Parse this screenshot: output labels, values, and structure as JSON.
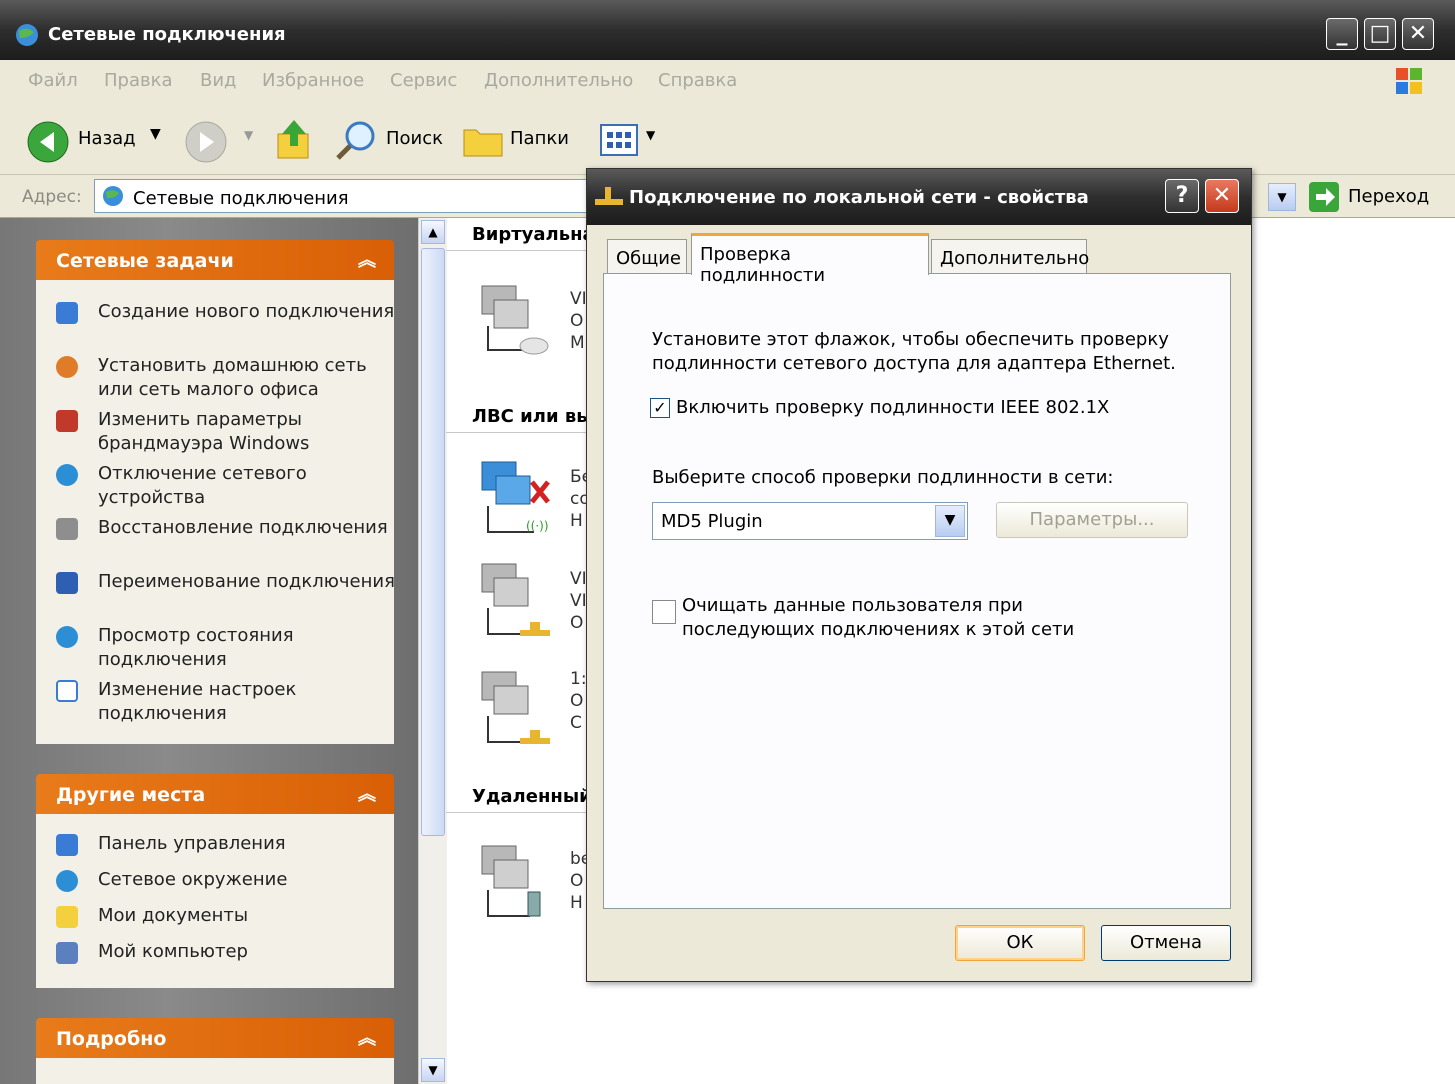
{
  "window": {
    "title": "Сетевые подключения"
  },
  "menu": [
    "Файл",
    "Правка",
    "Вид",
    "Избранное",
    "Сервис",
    "Дополнительно",
    "Справка"
  ],
  "toolbar": {
    "back": "Назад",
    "search": "Поиск",
    "folders": "Папки"
  },
  "address": {
    "label": "Адрес:",
    "value": "Сетевые подключения",
    "go": "Переход"
  },
  "left": {
    "tasks": {
      "title": "Сетевые задачи",
      "items": [
        "Создание нового подключения",
        "Установить домашнюю сеть или сеть малого офиса",
        "Изменить параметры брандмауэра Windows",
        "Отключение сетевого устройства",
        "Восстановление подключения",
        "Переименование подключения",
        "Просмотр состояния подключения",
        "Изменение настроек подключения"
      ]
    },
    "places": {
      "title": "Другие места",
      "items": [
        "Панель управления",
        "Сетевое окружение",
        "Мои документы",
        "Мой компьютер"
      ]
    },
    "details": {
      "title": "Подробно"
    }
  },
  "content": {
    "sections": [
      "Виртуальна",
      "ЛВС или вы",
      "Удаленный"
    ],
    "items": [
      {
        "l1": "VI",
        "l2": "O",
        "l3": "M"
      },
      {
        "l1": "Бе",
        "l2": "co",
        "l3": "Н"
      },
      {
        "l1": "VI",
        "l2": "VI",
        "l3": "O"
      },
      {
        "l1": "1:",
        "l2": "O",
        "l3": "C"
      },
      {
        "l1": "be",
        "l2": "O",
        "l3": "H"
      }
    ]
  },
  "dialog": {
    "title": "Подключение по локальной сети - свойства",
    "tabs": [
      "Общие",
      "Проверка подлинности",
      "Дополнительно"
    ],
    "intro": [
      "Установите этот флажок, чтобы обеспечить проверку",
      "подлинности сетевого доступа для адаптера Ethernet."
    ],
    "enable_label": "Включить проверку подлинности IEEE 802.1X",
    "method_label": "Выберите способ проверки подлинности в сети:",
    "method_value": "MD5 Plugin",
    "params_button": "Параметры...",
    "clear_label": [
      "Очищать данные пользователя при",
      "последующих подключениях к этой сети"
    ],
    "ok": "ОК",
    "cancel": "Отмена"
  }
}
